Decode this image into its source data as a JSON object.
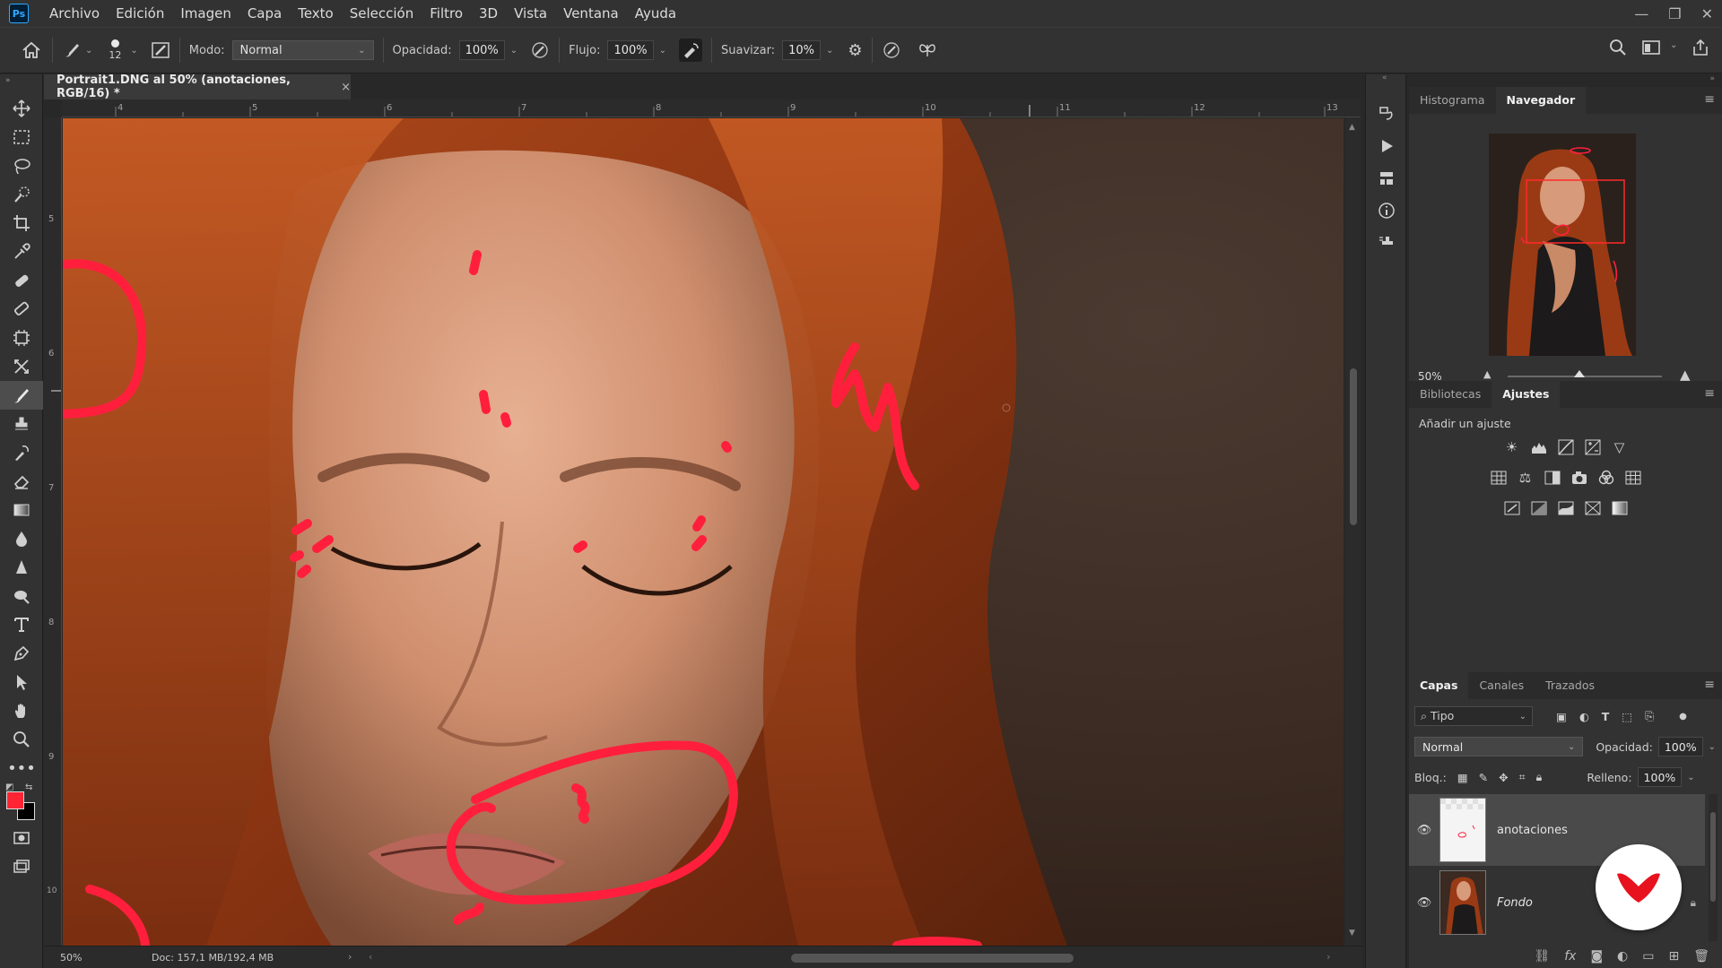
{
  "app": {
    "logo": "Ps"
  },
  "menu": [
    "Archivo",
    "Edición",
    "Imagen",
    "Capa",
    "Texto",
    "Selección",
    "Filtro",
    "3D",
    "Vista",
    "Ventana",
    "Ayuda"
  ],
  "options": {
    "brush_size": "12",
    "mode_label": "Modo:",
    "mode_value": "Normal",
    "opacity_label": "Opacidad:",
    "opacity_value": "100%",
    "flow_label": "Flujo:",
    "flow_value": "100%",
    "smoothing_label": "Suavizar:",
    "smoothing_value": "10%"
  },
  "document": {
    "tab_title": "Portrait1.DNG al 50% (anotaciones, RGB/16) *",
    "close_glyph": "×",
    "ruler_top": [
      "4",
      "5",
      "6",
      "7",
      "8",
      "9",
      "10",
      "11",
      "12",
      "13"
    ],
    "ruler_left": [
      "5",
      "6",
      "7",
      "8",
      "9",
      "10"
    ],
    "status_zoom": "50%",
    "status_doc": "Doc: 157,1 MB/192,4 MB",
    "annotation_color": "#ff1f3d"
  },
  "navigator": {
    "tabs": [
      "Histograma",
      "Navegador"
    ],
    "zoom": "50%"
  },
  "adjustments": {
    "tabs": [
      "Bibliotecas",
      "Ajustes"
    ],
    "add_label": "Añadir un ajuste"
  },
  "layers": {
    "tabs": [
      "Capas",
      "Canales",
      "Trazados"
    ],
    "filter_label": "Tipo",
    "blend_mode": "Normal",
    "opacity_label": "Opacidad:",
    "opacity_value": "100%",
    "lock_label": "Bloq.:",
    "fill_label": "Relleno:",
    "fill_value": "100%",
    "items": [
      {
        "name": "anotaciones"
      },
      {
        "name": "Fondo"
      }
    ]
  },
  "colors": {
    "foreground": "#ff2433",
    "background": "#000000",
    "accent": "#ff1f3d"
  }
}
